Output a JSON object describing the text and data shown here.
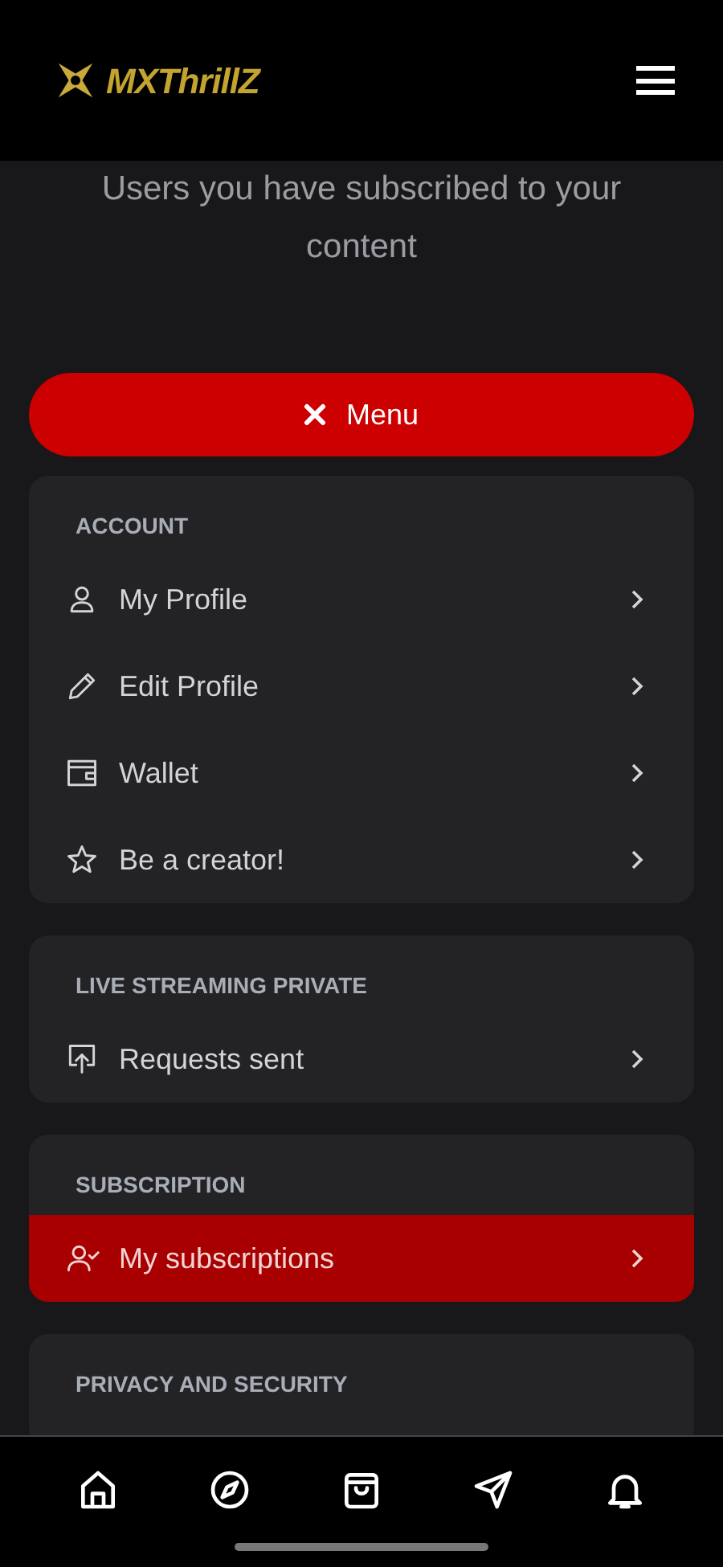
{
  "header": {
    "logo_text": "MXThrillZ"
  },
  "intro": {
    "lines": [
      "Users you have subscribed to your",
      "content"
    ]
  },
  "menu_button": {
    "label": "Menu"
  },
  "sections": [
    {
      "title": "ACCOUNT",
      "items": [
        {
          "kind": "person",
          "label": "My Profile",
          "selected": false
        },
        {
          "kind": "pencil",
          "label": "Edit Profile",
          "selected": false
        },
        {
          "kind": "wallet",
          "label": "Wallet",
          "selected": false
        },
        {
          "kind": "star",
          "label": "Be a creator!",
          "selected": false
        }
      ]
    },
    {
      "title": "LIVE STREAMING PRIVATE",
      "items": [
        {
          "kind": "upload",
          "label": "Requests sent",
          "selected": false
        }
      ]
    },
    {
      "title": "SUBSCRIPTION",
      "items": [
        {
          "kind": "person-check",
          "label": "My subscriptions",
          "selected": true
        }
      ]
    },
    {
      "title": "PRIVACY AND SECURITY"
    }
  ],
  "bottom_nav": [
    {
      "kind": "home"
    },
    {
      "kind": "compass"
    },
    {
      "kind": "bag"
    },
    {
      "kind": "send"
    },
    {
      "kind": "bell"
    }
  ]
}
